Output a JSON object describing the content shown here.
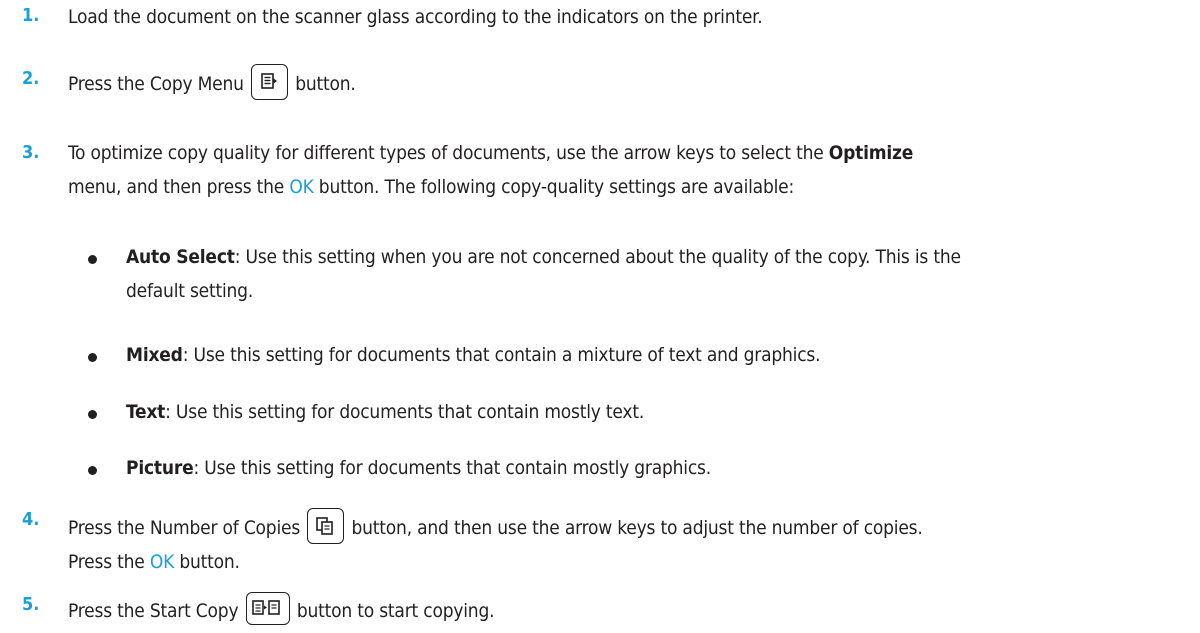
{
  "steps": [
    {
      "num": "1.",
      "text": "Load the document on the scanner glass according to the indicators on the printer."
    },
    {
      "num": "2.",
      "pre": "Press the Copy Menu",
      "post": "button.",
      "icon": "copy-menu-icon"
    },
    {
      "num": "3.",
      "t1": "To optimize copy quality for different types of documents, use the arrow keys to select the ",
      "t1b": "Optimize",
      "t2": "menu, and then press the ",
      "ok": "OK",
      "t3": " button. The following copy-quality settings are available:",
      "bullets": [
        {
          "label": "Auto Select",
          "text": ": Use this setting when you are not concerned about the quality of the copy. This is the",
          "text2": "default setting."
        },
        {
          "label": "Mixed",
          "text": ": Use this setting for documents that contain a mixture of text and graphics."
        },
        {
          "label": "Text",
          "text": ": Use this setting for documents that contain mostly text."
        },
        {
          "label": "Picture",
          "text": ": Use this setting for documents that contain mostly graphics."
        }
      ]
    },
    {
      "num": "4.",
      "pre": "Press the Number of Copies",
      "post": "button, and then use the arrow keys to adjust the number of copies.",
      "l2a": "Press the ",
      "ok": "OK",
      "l2b": " button.",
      "icon": "number-of-copies-icon"
    },
    {
      "num": "5.",
      "pre": "Press the Start Copy",
      "post": "button to start copying.",
      "icon": "start-copy-icon"
    }
  ],
  "colors": {
    "accent": "#1a9fd9",
    "text": "#231f20"
  }
}
